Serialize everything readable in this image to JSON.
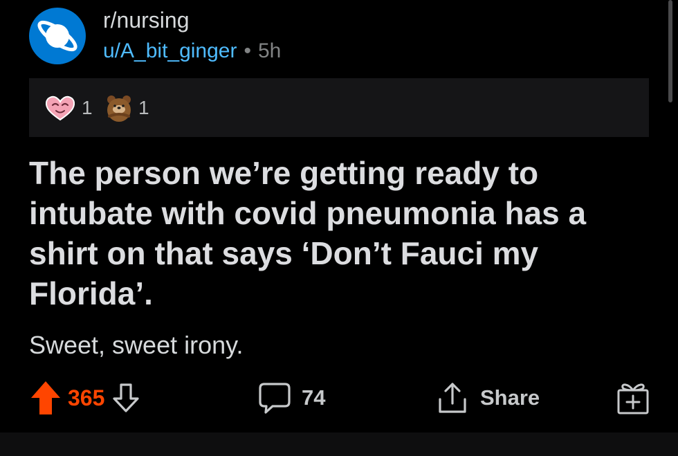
{
  "header": {
    "subreddit": "r/nursing",
    "username": "u/A_bit_ginger",
    "separator": "•",
    "age": "5h",
    "avatar_icon": "reddit-planet-icon",
    "avatar_color": "#0079d3"
  },
  "awards": [
    {
      "icon": "heart-eyes-award-icon",
      "count": "1"
    },
    {
      "icon": "bear-hug-award-icon",
      "count": "1"
    }
  ],
  "post": {
    "title": "The person we’re getting ready to intubate with covid pneumonia has a shirt on that says ‘Don’t Fauci my Florida’.",
    "body": "Sweet, sweet irony."
  },
  "actions": {
    "upvote_icon": "upvote-arrow-icon",
    "score": "365",
    "downvote_icon": "downvote-arrow-icon",
    "comment_icon": "comment-bubble-icon",
    "comments": "74",
    "share_icon": "share-icon",
    "share_label": "Share",
    "award_icon": "gift-award-icon"
  },
  "colors": {
    "background": "#000000",
    "upvote_active": "#ff4500",
    "link": "#4fbcff",
    "muted": "#818384"
  }
}
